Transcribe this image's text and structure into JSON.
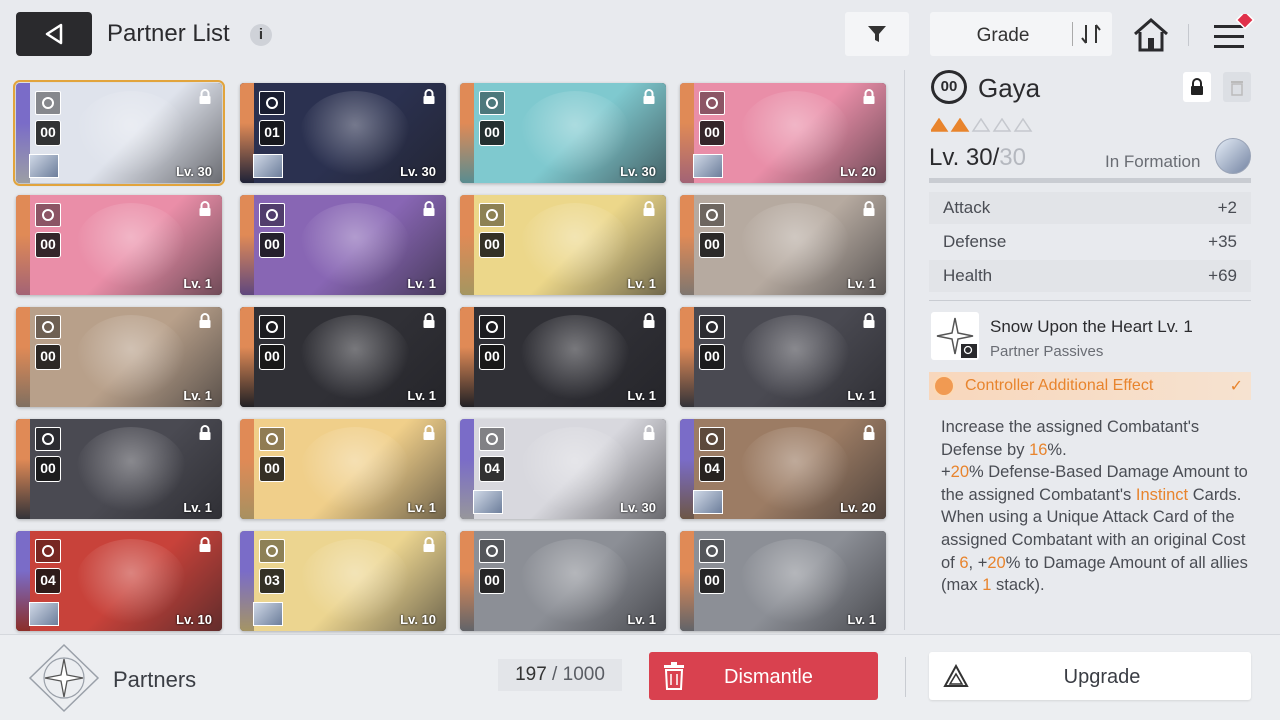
{
  "header": {
    "title": "Partner List",
    "info_icon": "info-icon",
    "grade_label": "Grade",
    "icons": [
      "back-arrow-icon",
      "filter-icon",
      "sort-icon",
      "home-icon",
      "menu-icon"
    ]
  },
  "partners": [
    {
      "rank": "00",
      "level": "Lv. 30",
      "role": "controller",
      "locked": true,
      "selected": true,
      "accent": "#7a6cc8",
      "tint": "#dfe3ec",
      "formation": true
    },
    {
      "rank": "01",
      "level": "Lv. 30",
      "role": "shield",
      "locked": true,
      "accent": "#e08a56",
      "tint": "#2b3150",
      "formation": true
    },
    {
      "rank": "00",
      "level": "Lv. 30",
      "role": "controller",
      "locked": true,
      "accent": "#e08a56",
      "tint": "#7fc9cf"
    },
    {
      "rank": "00",
      "level": "Lv. 20",
      "role": "striker",
      "locked": true,
      "accent": "#e08a56",
      "tint": "#e98ea8",
      "formation": true
    },
    {
      "rank": "00",
      "level": "Lv. 1",
      "role": "striker",
      "locked": true,
      "accent": "#e08a56",
      "tint": "#ea8ea8"
    },
    {
      "rank": "00",
      "level": "Lv. 1",
      "role": "striker",
      "locked": true,
      "accent": "#e08a56",
      "tint": "#8866b4"
    },
    {
      "rank": "00",
      "level": "Lv. 1",
      "role": "shield",
      "locked": true,
      "accent": "#e08a56",
      "tint": "#ecd78a"
    },
    {
      "rank": "00",
      "level": "Lv. 1",
      "role": "striker",
      "locked": true,
      "accent": "#e08a56",
      "tint": "#b6aaa0"
    },
    {
      "rank": "00",
      "level": "Lv. 1",
      "role": "striker",
      "locked": true,
      "accent": "#e08a56",
      "tint": "#b8a08a"
    },
    {
      "rank": "00",
      "level": "Lv. 1",
      "role": "ranger",
      "locked": true,
      "accent": "#e08a56",
      "tint": "#303036"
    },
    {
      "rank": "00",
      "level": "Lv. 1",
      "role": "ranger",
      "locked": true,
      "accent": "#e08a56",
      "tint": "#303036"
    },
    {
      "rank": "00",
      "level": "Lv. 1",
      "role": "ranger",
      "locked": true,
      "accent": "#e08a56",
      "tint": "#4a4a52"
    },
    {
      "rank": "00",
      "level": "Lv. 1",
      "role": "ranger",
      "locked": true,
      "accent": "#e08a56",
      "tint": "#4a4a52"
    },
    {
      "rank": "00",
      "level": "Lv. 1",
      "role": "controller",
      "locked": true,
      "accent": "#e08a56",
      "tint": "#f0cf8a"
    },
    {
      "rank": "04",
      "level": "Lv. 30",
      "role": "striker",
      "locked": true,
      "accent": "#7a6cc8",
      "tint": "#d8d8de",
      "formation": true
    },
    {
      "rank": "04",
      "level": "Lv. 20",
      "role": "ranger",
      "locked": true,
      "accent": "#7a6cc8",
      "tint": "#9c7c64",
      "formation": true
    },
    {
      "rank": "04",
      "level": "Lv. 10",
      "role": "psionic",
      "locked": true,
      "accent": "#7a6cc8",
      "tint": "#c8423a",
      "formation": true
    },
    {
      "rank": "03",
      "level": "Lv. 10",
      "role": "controller",
      "locked": true,
      "accent": "#7a6cc8",
      "tint": "#ecd590",
      "formation": true
    },
    {
      "rank": "00",
      "level": "Lv. 1",
      "role": "striker",
      "locked": false,
      "accent": "#e08a56",
      "tint": "#8c8f96"
    },
    {
      "rank": "00",
      "level": "Lv. 1",
      "role": "striker",
      "locked": false,
      "accent": "#e08a56",
      "tint": "#8c8f96"
    }
  ],
  "detail": {
    "rank": "00",
    "name": "Gaya",
    "stars_filled": 2,
    "stars_total": 5,
    "level_current": "Lv. 30/",
    "level_max": "30",
    "formation_label": "In Formation",
    "stats": [
      {
        "label": "Attack",
        "value": "+2"
      },
      {
        "label": "Defense",
        "value": "+35"
      },
      {
        "label": "Health",
        "value": "+69"
      }
    ],
    "skill_name": "Snow Upon the Heart Lv. 1",
    "skill_type": "Partner Passives",
    "effect_label": "Controller Additional Effect",
    "desc": {
      "p1": "Increase the assigned Combatant's Defense by ",
      "v1": "16",
      "p2": "%.",
      "p3": "+",
      "v2": "20",
      "p4": "% Defense-Based Damage Amount to the assigned Combatant's ",
      "v3": "Instinct",
      "p5": " Cards.",
      "p6": "When using a Unique Attack Card of the assigned Combatant with an original Cost of ",
      "v4": "6",
      "p7": ", +",
      "v5": "20",
      "p8": "% to Damage Amount of all allies (max ",
      "v6": "1",
      "p9": " stack)."
    }
  },
  "footer": {
    "section_label": "Partners",
    "count_current": "197",
    "count_sep": " / ",
    "count_max": "1000",
    "dismantle_label": "Dismantle",
    "upgrade_label": "Upgrade"
  },
  "colors": {
    "accent": "#e8842d",
    "danger": "#d9414f",
    "dark": "#2a2a2d"
  }
}
